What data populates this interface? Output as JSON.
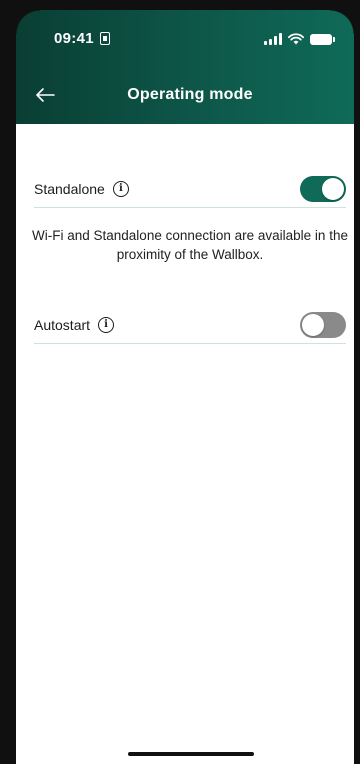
{
  "status_bar": {
    "time": "09:41"
  },
  "header": {
    "title": "Operating mode",
    "back_icon": "arrow-left-icon",
    "gradient_colors": [
      "#0a3e33",
      "#0f6a58"
    ]
  },
  "settings": {
    "standalone": {
      "label": "Standalone",
      "enabled": true,
      "info_icon": "info-icon"
    },
    "description": "Wi-Fi and Standalone connection are available in the proximity of the Wallbox.",
    "autostart": {
      "label": "Autostart",
      "enabled": false,
      "info_icon": "info-icon"
    }
  },
  "colors": {
    "toggle_on": "#0f6a57",
    "toggle_off": "#8a8a8a",
    "divider": "#cfe2dc"
  }
}
